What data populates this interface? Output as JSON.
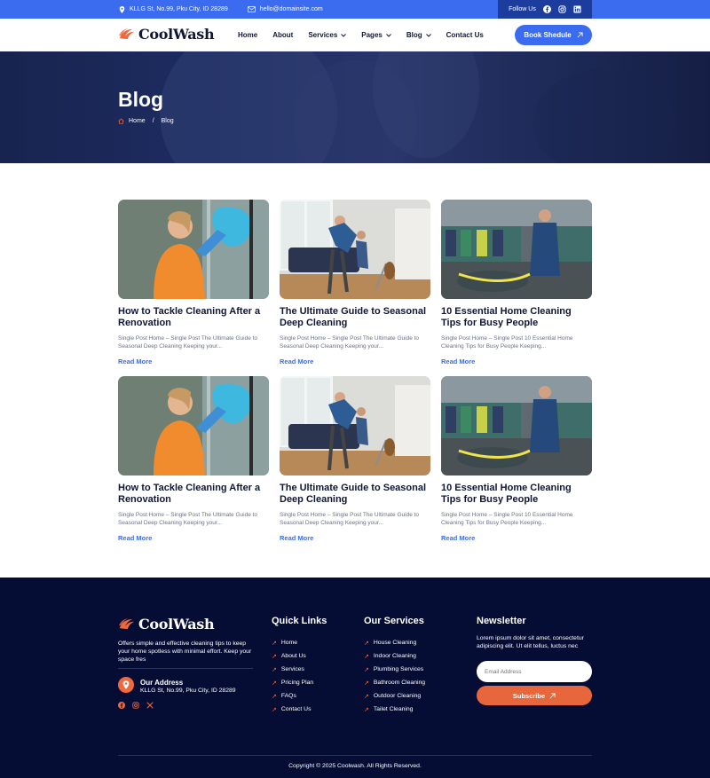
{
  "topbar": {
    "address": "KLLG St, No.99, Pku City, ID 28289",
    "email": "hello@domainsite.com",
    "follow_label": "Follow Us",
    "socials": [
      "facebook-icon",
      "instagram-icon",
      "linkedin-icon"
    ]
  },
  "brand": {
    "name": "CoolWash",
    "accent": "#3b6cf0",
    "orange": "#f0683d"
  },
  "nav": {
    "items": [
      {
        "label": "Home",
        "dropdown": false
      },
      {
        "label": "About",
        "dropdown": false
      },
      {
        "label": "Services",
        "dropdown": true
      },
      {
        "label": "Pages",
        "dropdown": true
      },
      {
        "label": "Blog",
        "dropdown": true
      },
      {
        "label": "Contact Us",
        "dropdown": false
      }
    ],
    "cta": "Book Shedule"
  },
  "hero": {
    "title": "Blog",
    "breadcrumb": {
      "home": "Home",
      "separator": "/",
      "current": "Blog"
    }
  },
  "posts": [
    {
      "title": "How to Tackle Cleaning After a Renovation",
      "excerpt": "Single Post Home – Single Post The Ultimate Guide to Seasonal Deep Cleaning Keeping your...",
      "link": "Read More",
      "image": "woman-wiping-glass"
    },
    {
      "title": "The Ultimate Guide to Seasonal Deep Cleaning",
      "excerpt": "Single Post Home – Single Post The Ultimate Guide to Seasonal Deep Cleaning Keeping your...",
      "link": "Read More",
      "image": "women-cleaning-living-room"
    },
    {
      "title": "10 Essential Home Cleaning Tips for Busy People",
      "excerpt": "Single Post Home – Single Post 10 Essential Home Cleaning Tips for Busy People Keeping...",
      "link": "Read More",
      "image": "worker-in-warehouse"
    },
    {
      "title": "How to Tackle Cleaning After a Renovation",
      "excerpt": "Single Post Home – Single Post The Ultimate Guide to Seasonal Deep Cleaning Keeping your...",
      "link": "Read More",
      "image": "woman-wiping-glass"
    },
    {
      "title": "The Ultimate Guide to Seasonal Deep Cleaning",
      "excerpt": "Single Post Home – Single Post The Ultimate Guide to Seasonal Deep Cleaning Keeping your...",
      "link": "Read More",
      "image": "women-cleaning-living-room"
    },
    {
      "title": "10 Essential Home Cleaning Tips for Busy People",
      "excerpt": "Single Post Home – Single Post 10 Essential Home Cleaning Tips for Busy People Keeping...",
      "link": "Read More",
      "image": "worker-in-warehouse"
    }
  ],
  "footer": {
    "about": "Offers simple and effective cleaning tips to keep your home spotless with minimal effort. Keep your space fres",
    "address_title": "Our Address",
    "address": "KLLG St, No.99, Pku City, ID 28289",
    "quick_links_title": "Quick Links",
    "quick_links": [
      "Home",
      "About Us",
      "Services",
      "Pricing Plan",
      "FAQs",
      "Contact Us"
    ],
    "services_title": "Our Services",
    "services": [
      "House Cleaning",
      "Indoor Cleaning",
      "Plumbing Services",
      "Bathroom Cleaning",
      "Outdoor Cleaning",
      "Tailet Cleaning"
    ],
    "newsletter_title": "Newsletter",
    "newsletter_text": "Lorem ipsum dolor sit amet, consectetur adipiscing elit. Ut elit tellus, luctus nec",
    "email_placeholder": "Email Address",
    "subscribe": "Subscribe",
    "copyright": "Copyright © 2025 Coolwash. All Rights Reserved."
  }
}
